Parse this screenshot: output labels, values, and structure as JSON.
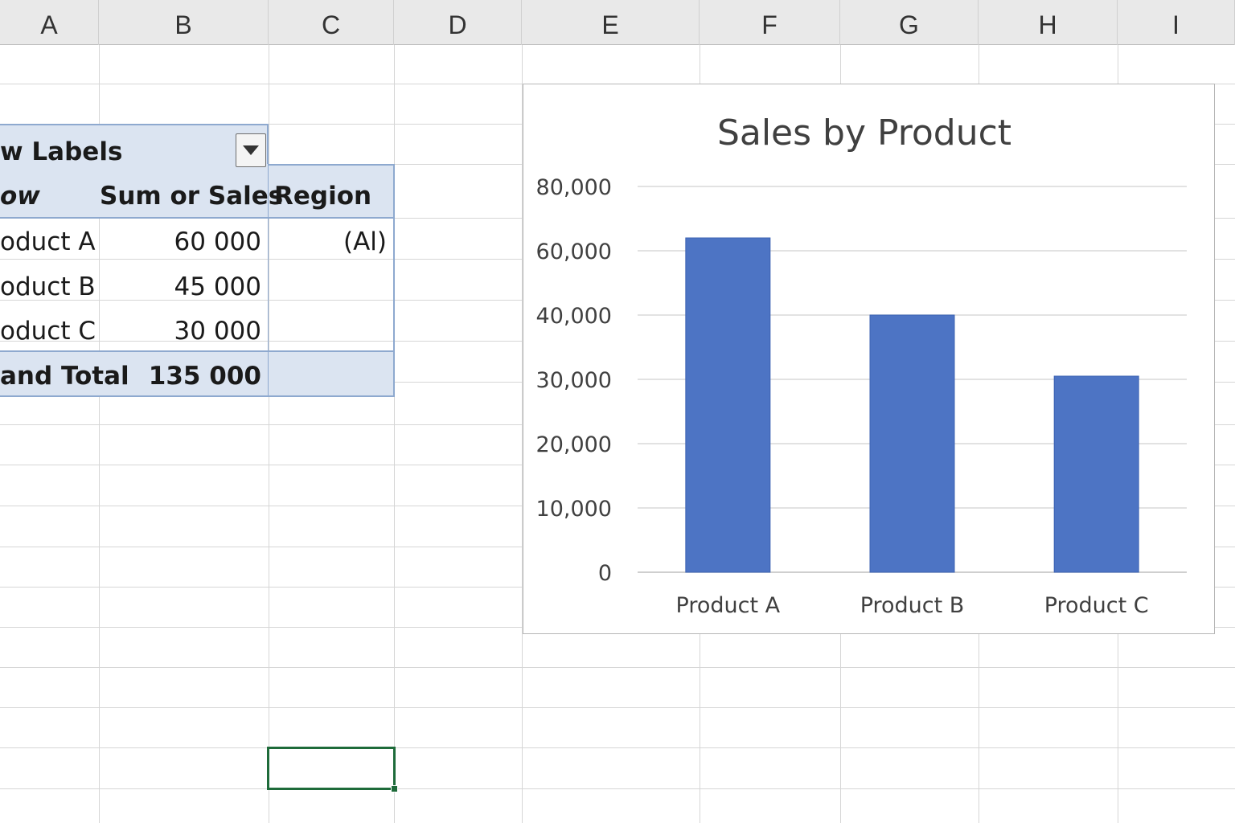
{
  "columns": [
    "A",
    "B",
    "C",
    "D",
    "E",
    "F",
    "G",
    "H",
    "I"
  ],
  "pivot": {
    "header_label": "w Labels",
    "subheader": {
      "row_label": "ow",
      "sum_label": "Sum or Sales",
      "region_label": "Region"
    },
    "rows": [
      {
        "label": "oduct A",
        "value": "60 000",
        "region": "(Al)"
      },
      {
        "label": "oduct B",
        "value": "45 000",
        "region": ""
      },
      {
        "label": "oduct C",
        "value": "30 000",
        "region": ""
      }
    ],
    "total": {
      "label": "and Total",
      "value": "135 000"
    }
  },
  "chart_data": {
    "type": "bar",
    "title": "Sales by Product",
    "categories": [
      "Product A",
      "Product B",
      "Product C"
    ],
    "values": [
      64000,
      40000,
      30500
    ],
    "ylim": [
      0,
      80000
    ],
    "yticks": [
      {
        "value": 0,
        "label": "0"
      },
      {
        "value": 10000,
        "label": "10,000"
      },
      {
        "value": 20000,
        "label": "20,000"
      },
      {
        "value": 30000,
        "label": "30,000"
      },
      {
        "value": 40000,
        "label": "40,000"
      },
      {
        "value": 60000,
        "label": "60,000"
      },
      {
        "value": 80000,
        "label": "80,000"
      }
    ],
    "bar_color": "#4d74c4",
    "grid": true,
    "legend": "none"
  }
}
